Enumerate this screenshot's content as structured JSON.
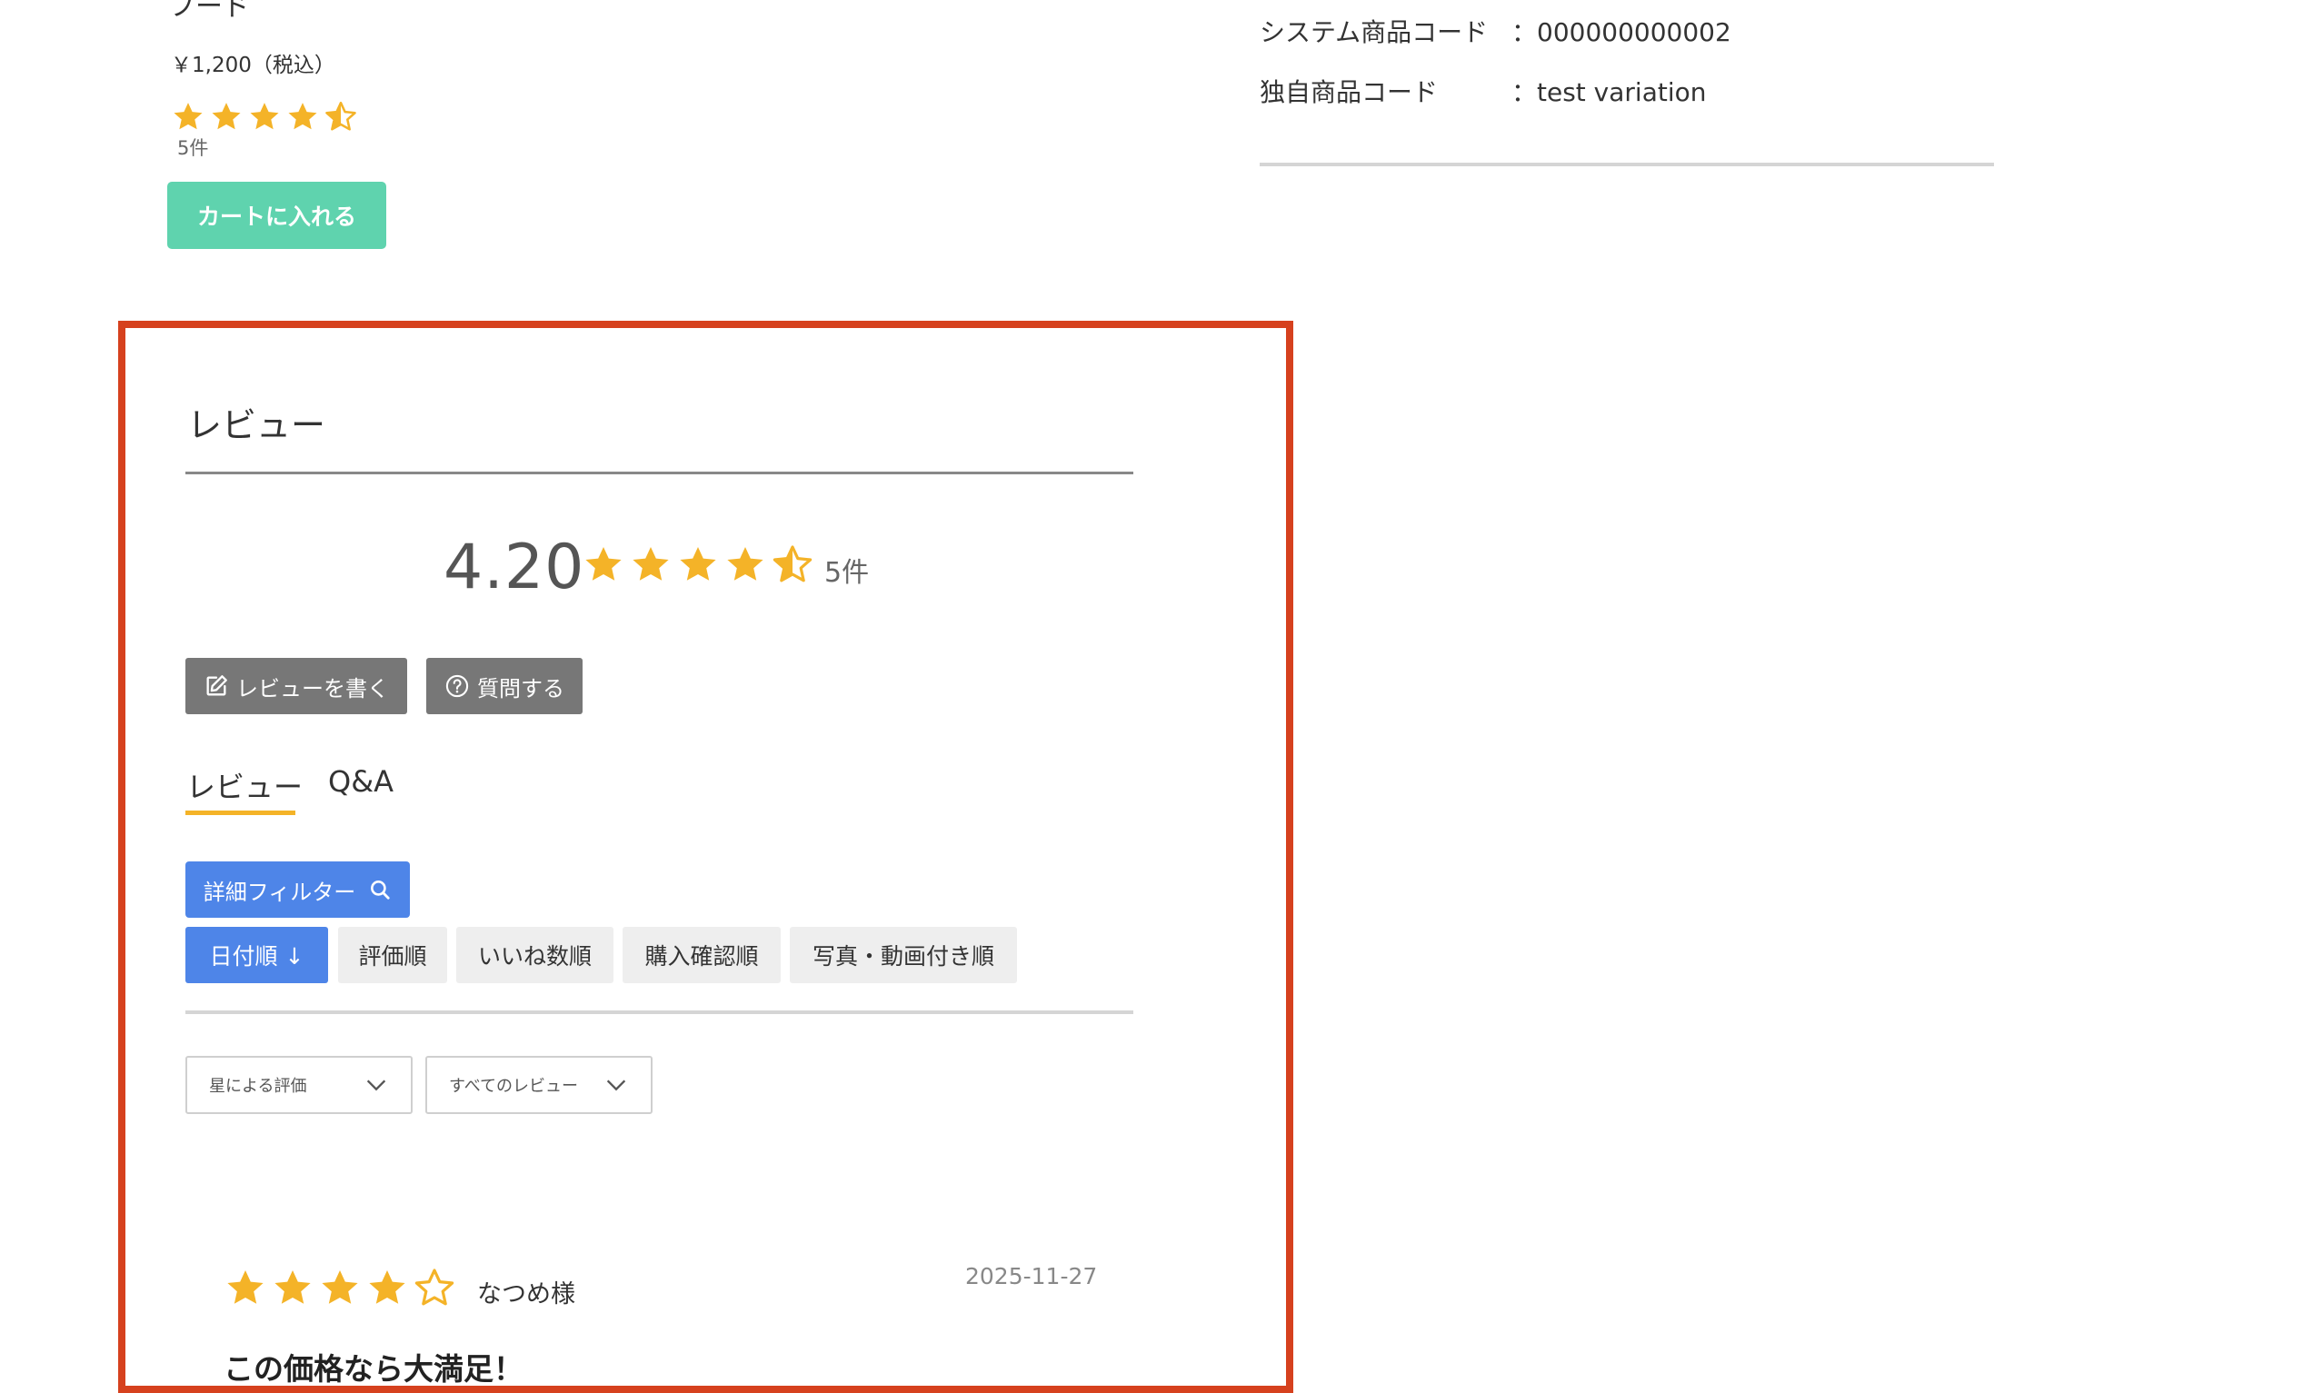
{
  "product": {
    "name_partial": "フード",
    "price": "￥1,200（税込）",
    "rating_count": "5件",
    "cart_button": "カートに入れる"
  },
  "specs": [
    {
      "label": "システム商品コード",
      "value": "：000000000002"
    },
    {
      "label": "独自商品コード",
      "value": "：test variation"
    }
  ],
  "review_section": {
    "title": "レビュー",
    "average": "4.20",
    "average_rating": 4.2,
    "count": "5件",
    "write_button": "レビューを書く",
    "ask_button": "質問する",
    "tabs": [
      "レビュー",
      "Q&A"
    ],
    "active_tab": "レビュー",
    "filter_button": "詳細フィルター",
    "sort_buttons": [
      {
        "label": "日付順 ↓",
        "active": true
      },
      {
        "label": "評価順",
        "active": false
      },
      {
        "label": "いいね数順",
        "active": false
      },
      {
        "label": "購入確認順",
        "active": false
      },
      {
        "label": "写真・動画付き順",
        "active": false
      }
    ],
    "star_select": "星による評価",
    "review_select": "すべてのレビュー",
    "reviews": [
      {
        "rating": 4,
        "author": "なつめ様",
        "date": "2025-11-27",
        "headline": "この価格なら大満足！"
      }
    ]
  },
  "colors": {
    "star": "#f4b328",
    "accent_blue": "#4e85e8",
    "cart_green": "#5fd3ae",
    "highlight_frame": "#d6411e"
  },
  "icons": [
    "star-icon",
    "star-half-icon",
    "star-empty-icon",
    "edit-icon",
    "question-circle-icon",
    "search-icon",
    "chevron-down-icon"
  ]
}
